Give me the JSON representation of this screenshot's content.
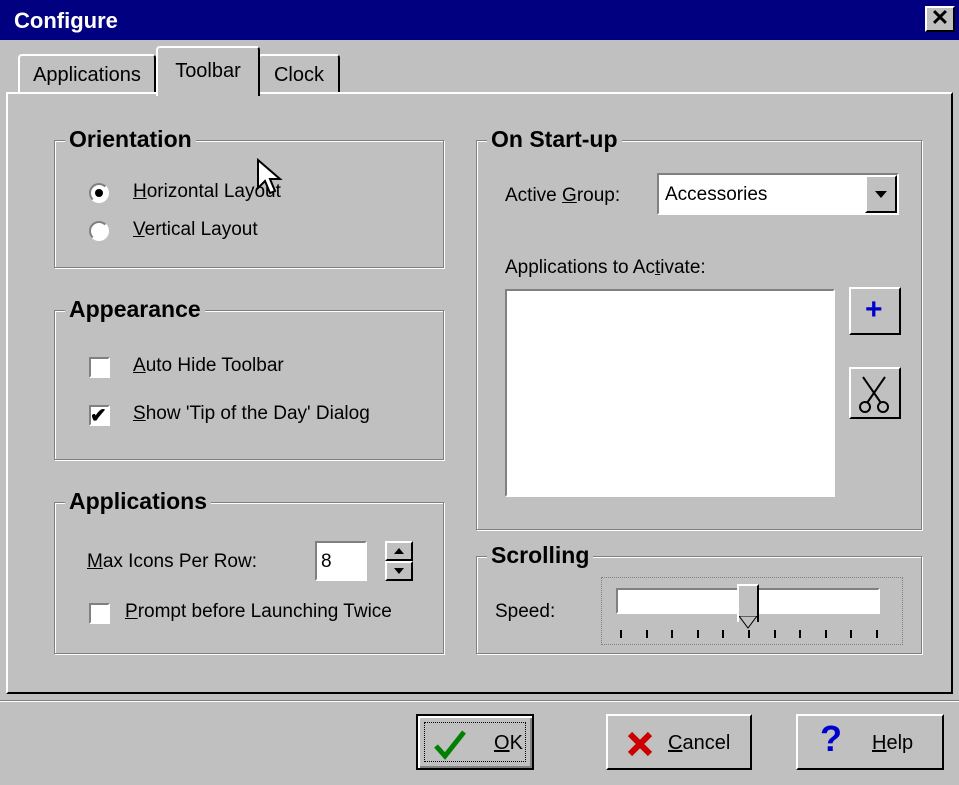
{
  "window": {
    "title": "Configure",
    "close_glyph": "✕"
  },
  "tabs": [
    {
      "label": "Applications",
      "active": false
    },
    {
      "label": "Toolbar",
      "active": true
    },
    {
      "label": "Clock",
      "active": false
    }
  ],
  "orientation": {
    "title": "Orientation",
    "horizontal": {
      "label_hot": "H",
      "label_rest": "orizontal Layout",
      "selected": true
    },
    "vertical": {
      "label_hot": "V",
      "label_rest": "ertical Layout",
      "selected": false
    }
  },
  "appearance": {
    "title": "Appearance",
    "auto_hide": {
      "label_hot": "A",
      "label_rest": "uto Hide Toolbar",
      "checked": false
    },
    "show_tip": {
      "label_hot": "S",
      "label_rest": "how 'Tip of the Day' Dialog",
      "checked": true
    }
  },
  "applications": {
    "title": "Applications",
    "max_icons_hot": "M",
    "max_icons_rest": "ax Icons Per Row:",
    "max_icons_value": "8",
    "prompt": {
      "label_hot": "P",
      "label_rest": "rompt before Launching Twice",
      "checked": false
    }
  },
  "startup": {
    "title": "On Start-up",
    "active_group_pre": "Active ",
    "active_group_hot": "G",
    "active_group_post": "roup:",
    "active_group_value": "Accessories",
    "apps_pre": "Applications to Ac",
    "apps_hot": "t",
    "apps_post": "ivate:",
    "add_glyph": "+",
    "remove_icon": "scissors-icon"
  },
  "scrolling": {
    "title": "Scrolling",
    "speed_label": "Speed:",
    "speed_fraction": 0.5,
    "tick_count": 11
  },
  "buttons": {
    "ok": {
      "hot": "O",
      "rest": "K"
    },
    "cancel": {
      "hot": "C",
      "rest": "ancel"
    },
    "help": {
      "hot": "H",
      "rest": "elp"
    }
  },
  "colors": {
    "title_bar": "#000080",
    "face": "#c0c0c0",
    "ok_check": "#008000",
    "cancel_x": "#cc0000",
    "help_q": "#0000cc"
  }
}
